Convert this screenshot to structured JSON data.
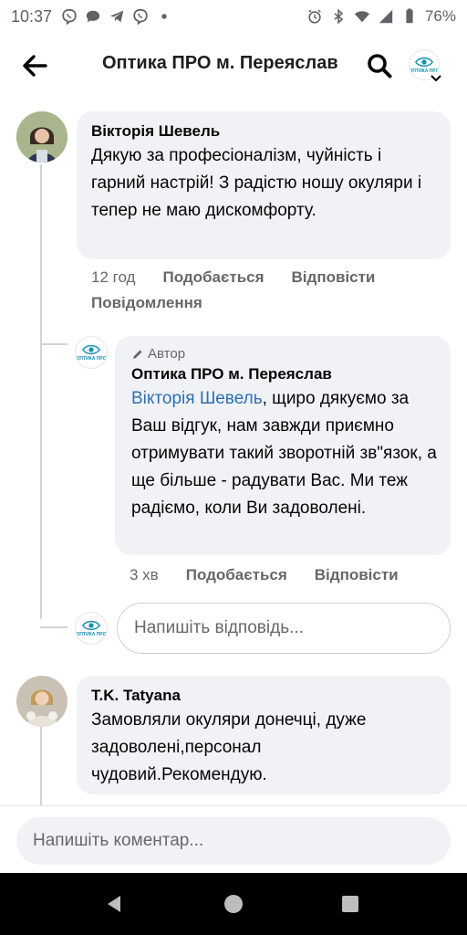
{
  "status_bar": {
    "time": "10:37",
    "battery": "76%",
    "icons": [
      "viber-icon",
      "chat-icon",
      "telegram-icon",
      "viber-icon",
      "dot-icon",
      "alarm-icon",
      "bluetooth-icon",
      "wifi-icon",
      "signal-icon",
      "battery-icon"
    ]
  },
  "header": {
    "title": "Оптика ПРО м. Переяслав",
    "back_icon": "back-arrow-icon",
    "search_icon": "search-icon"
  },
  "page_logo_text": "ОПТИКА ПРО",
  "comments": [
    {
      "author": "Вікторія Шевель",
      "text": "Дякую за професіоналізм, чуйність і гарний настрій! З радістю ношу окуляри і тепер не маю дискомфорту.",
      "time": "12 год",
      "like": "Подобається",
      "reply": "Відповісти",
      "message": "Повідомлення"
    },
    {
      "badge": "Автор",
      "author": "Оптика ПРО м. Переяслав",
      "mention": "Вікторія Шевель",
      "text": ", щиро дякуємо за Ваш відгук, нам завжди приємно отримувати такий зворотній зв\"язок, а ще більше - радувати Вас. Ми теж радіємо, коли Ви задоволені.",
      "time": "3 хв",
      "like": "Подобається",
      "reply": "Відповісти"
    },
    {
      "author": "T.K. Tatyana",
      "text": "Замовляли окуляри донечці, дуже задоволені,персонал чудовий.Рекомендую."
    }
  ],
  "reply_input": {
    "placeholder": "Напишіть відповідь..."
  },
  "comment_input": {
    "placeholder": "Напишіть коментар..."
  },
  "nav": {
    "back": "nav-back-icon",
    "home": "nav-home-icon",
    "recents": "nav-recents-icon"
  }
}
